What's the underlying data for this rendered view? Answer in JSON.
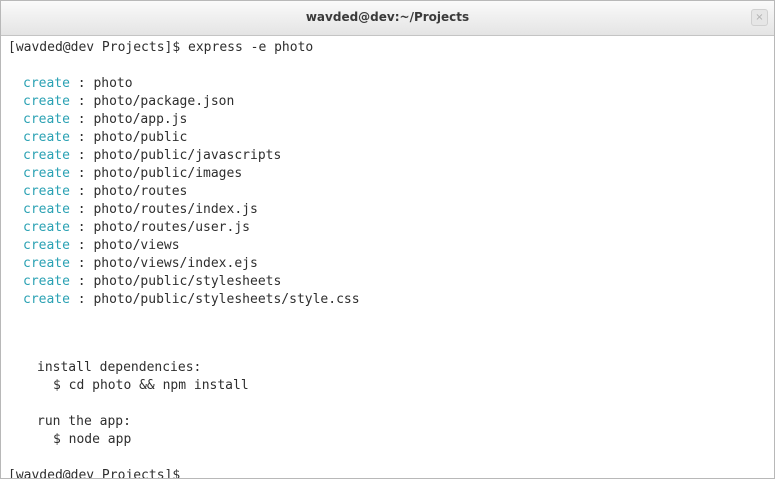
{
  "window": {
    "title": "wavded@dev:~/Projects",
    "close_glyph": "×"
  },
  "terminal": {
    "prompt": "[wavded@dev Projects]$ ",
    "command": "express -e photo",
    "create_keyword": "create",
    "create_paths": [
      "photo",
      "photo/package.json",
      "photo/app.js",
      "photo/public",
      "photo/public/javascripts",
      "photo/public/images",
      "photo/routes",
      "photo/routes/index.js",
      "photo/routes/user.js",
      "photo/views",
      "photo/views/index.ejs",
      "photo/public/stylesheets",
      "photo/public/stylesheets/style.css"
    ],
    "install_heading": "install dependencies:",
    "install_command": "$ cd photo && npm install",
    "run_heading": "run the app:",
    "run_command": "$ node app",
    "cursor": "_"
  },
  "colors": {
    "create_keyword": "#2aa1b3",
    "text": "#2e2e2e",
    "titlebar": "#e8e8e8"
  }
}
